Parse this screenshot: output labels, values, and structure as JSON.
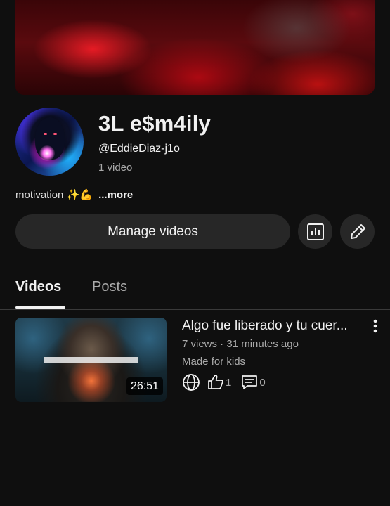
{
  "channel": {
    "name": "3L e$m4ily",
    "handle": "@EddieDiaz-j1o",
    "video_count": "1 video",
    "description": "motivation ✨💪",
    "more_label": "...more"
  },
  "actions": {
    "manage_videos_label": "Manage videos",
    "analytics_icon": "bar-chart-icon",
    "edit_icon": "pencil-icon"
  },
  "tabs": [
    {
      "label": "Videos",
      "selected": true
    },
    {
      "label": "Posts",
      "selected": false
    }
  ],
  "videos": [
    {
      "title": "Algo fue liberado y tu cuer...",
      "meta": "7 views · 31 minutes ago",
      "audience": "Made for kids",
      "duration": "26:51",
      "visibility_icon": "globe-icon",
      "likes": "1",
      "comments": "0"
    }
  ],
  "colors": {
    "background": "#0f0f0f",
    "button_bg": "#272727",
    "secondary_text": "#aaaaaa"
  }
}
